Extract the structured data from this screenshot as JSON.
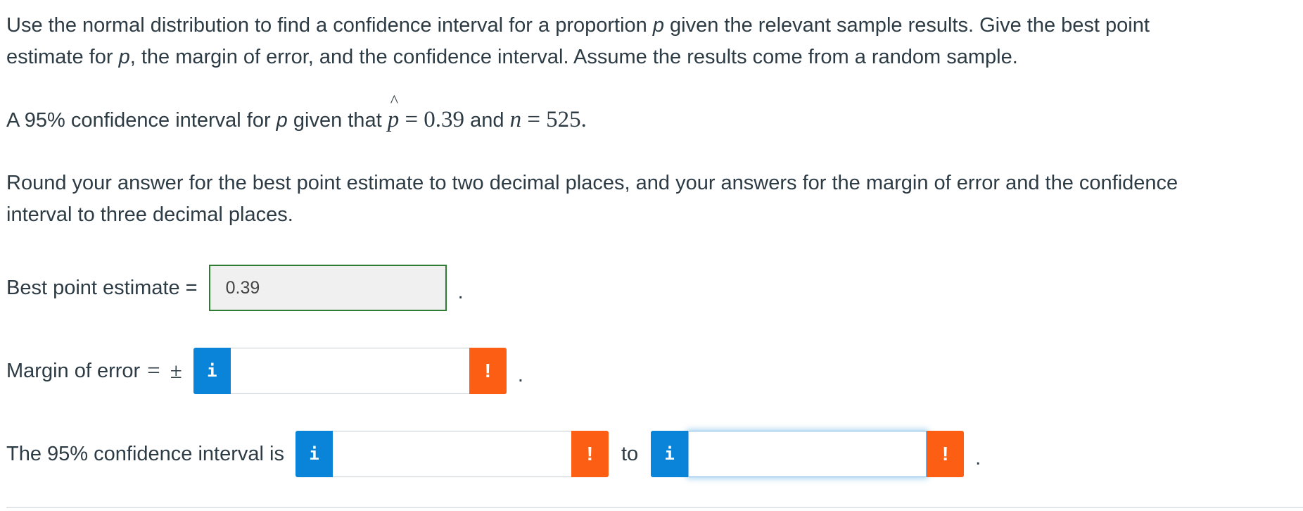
{
  "question": {
    "instructions_line1": "Use the normal distribution to find a confidence interval for a proportion ",
    "instructions_var_p": "p",
    "instructions_line1b": " given the relevant sample results. Give the best point",
    "instructions_line2a": "estimate for ",
    "instructions_line2_var": "p",
    "instructions_line2b": ", the margin of error, and the confidence interval. Assume the results come from a random sample.",
    "prompt_a": "A 95% confidence interval for ",
    "prompt_var_p": "p",
    "prompt_b": " given that ",
    "phat_symbol": "p",
    "hat_symbol": "^",
    "phat_eq": " = 0.39",
    "prompt_and": " and ",
    "n_symbol": "n",
    "n_eq": " = 525.",
    "rounding_line1": "Round your answer for the best point estimate to two decimal places, and your answers for the margin of error and the confidence",
    "rounding_line2": "interval to three decimal places."
  },
  "best_point": {
    "label": "Best point estimate =",
    "value": "0.39",
    "trailing": "."
  },
  "margin_of_error": {
    "label": "Margin of error",
    "equals": "=",
    "plus_minus": "±",
    "info_icon_label": "i",
    "warn_icon_label": "!",
    "value": "",
    "trailing": "."
  },
  "confidence_interval": {
    "label": "The 95% confidence interval is",
    "to_label": "to",
    "info_icon_label": "i",
    "warn_icon_label": "!",
    "lower_value": "",
    "upper_value": "",
    "trailing": "."
  },
  "colors": {
    "text": "#2d3b45",
    "info_blue": "#0a84d8",
    "warn_orange": "#fc5e13",
    "answered_border_green": "#2e7d32",
    "answered_bg": "#f0f0f0"
  }
}
